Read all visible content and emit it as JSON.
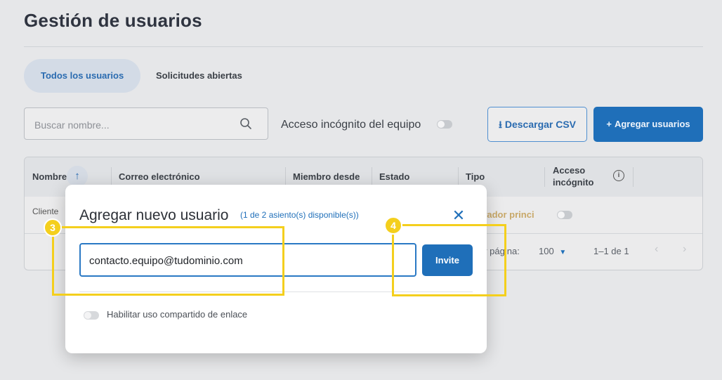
{
  "page": {
    "title": "Gestión de usuarios"
  },
  "tabs": [
    {
      "label": "Todos los usuarios",
      "active": true
    },
    {
      "label": "Solicitudes abiertas",
      "active": false
    }
  ],
  "toolbar": {
    "search_placeholder": "Buscar nombre...",
    "incognito_label": "Acceso incógnito del equipo",
    "download_csv_label": "Descargar CSV",
    "add_users_label": "Agregar usuarios"
  },
  "table": {
    "columns": [
      "Nombre",
      "Correo electrónico",
      "Miembro desde",
      "Estado",
      "Tipo",
      "Acceso incógnito"
    ],
    "rows": [
      {
        "name": "Cliente",
        "type": "trador princi"
      }
    ],
    "pager": {
      "per_page_label": "or página:",
      "per_page_value": "100",
      "range": "1–1 de 1"
    }
  },
  "modal": {
    "title": "Agregar nuevo usuario",
    "subtitle": "(1 de 2 asiento(s) disponible(s))",
    "email_value": "contacto.equipo@tudominio.com",
    "invite_label": "Invite",
    "share_link_label": "Habilitar uso compartido de enlace"
  },
  "callouts": [
    {
      "number": "3"
    },
    {
      "number": "4"
    }
  ],
  "colors": {
    "accent": "#1f6fb9",
    "callout": "#f4cf1d",
    "backdrop": "#e6e7e9"
  }
}
